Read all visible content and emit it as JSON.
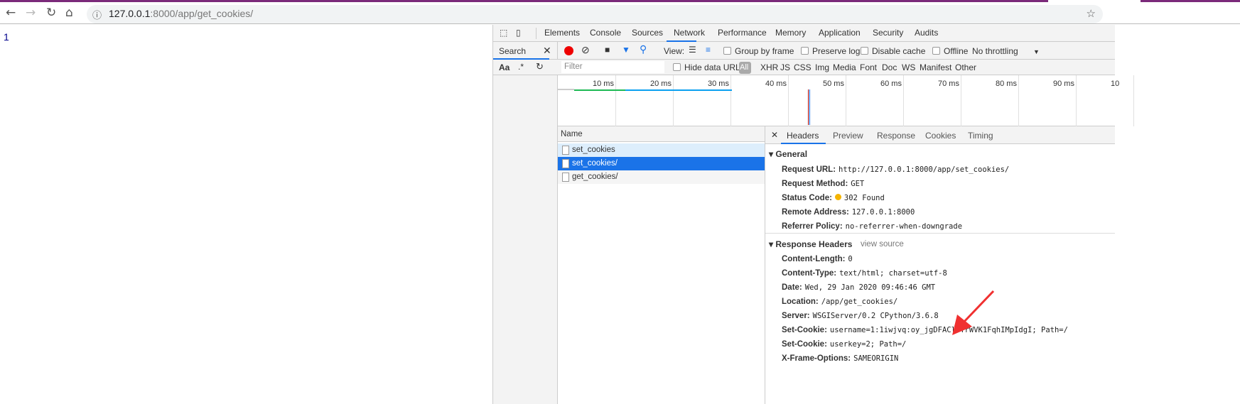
{
  "browser": {
    "url_host": "127.0.0.1",
    "url_rest": ":8000/app/get_cookies/",
    "icons": [
      "back-icon",
      "forward-icon",
      "reload-icon",
      "home-icon",
      "info-icon",
      "star-icon"
    ]
  },
  "page": {
    "content": "1"
  },
  "devtools": {
    "tabs": [
      "Elements",
      "Console",
      "Sources",
      "Network",
      "Performance",
      "Memory",
      "Application",
      "Security",
      "Audits"
    ],
    "active_tab": "Network",
    "search_label": "Search",
    "search_opts": {
      "case": "Aa",
      "regex": ".*"
    },
    "toolbar": {
      "view": "View:",
      "group_by_frame": "Group by frame",
      "preserve_log": "Preserve log",
      "disable_cache": "Disable cache",
      "offline": "Offline",
      "throttling": "No throttling"
    },
    "filter": {
      "placeholder": "Filter",
      "hide_data_urls": "Hide data URLs",
      "types": [
        "All",
        "XHR",
        "JS",
        "CSS",
        "Img",
        "Media",
        "Font",
        "Doc",
        "WS",
        "Manifest",
        "Other"
      ]
    },
    "timeline_ticks": [
      "10 ms",
      "20 ms",
      "30 ms",
      "40 ms",
      "50 ms",
      "60 ms",
      "70 ms",
      "80 ms",
      "90 ms",
      "10"
    ],
    "name_header": "Name",
    "requests": [
      {
        "name": "set_cookies",
        "state": "hover"
      },
      {
        "name": "set_cookies/",
        "state": "selected"
      },
      {
        "name": "get_cookies/",
        "state": "normal"
      }
    ],
    "detail_tabs": [
      "Headers",
      "Preview",
      "Response",
      "Cookies",
      "Timing"
    ],
    "active_detail_tab": "Headers",
    "general_title": "General",
    "general": [
      {
        "k": "Request URL:",
        "v": "http://127.0.0.1:8000/app/set_cookies/"
      },
      {
        "k": "Request Method:",
        "v": "GET"
      },
      {
        "k": "Status Code:",
        "v": "302 Found"
      },
      {
        "k": "Remote Address:",
        "v": "127.0.0.1:8000"
      },
      {
        "k": "Referrer Policy:",
        "v": "no-referrer-when-downgrade"
      }
    ],
    "status_color": "#f4b400",
    "response_title": "Response Headers",
    "view_source": "view source",
    "response": [
      {
        "k": "Content-Length:",
        "v": "0"
      },
      {
        "k": "Content-Type:",
        "v": "text/html; charset=utf-8"
      },
      {
        "k": "Date:",
        "v": "Wed, 29 Jan 2020 09:46:46 GMT"
      },
      {
        "k": "Location:",
        "v": "/app/get_cookies/"
      },
      {
        "k": "Server:",
        "v": "WSGIServer/0.2 CPython/3.6.8"
      },
      {
        "k": "Set-Cookie:",
        "v": "username=1:1iwjvq:oy_jgDFACl6YrWVK1FqhIMpIdgI; Path=/"
      },
      {
        "k": "Set-Cookie:",
        "v": "userkey=2; Path=/"
      },
      {
        "k": "X-Frame-Options:",
        "v": "SAMEORIGIN"
      }
    ]
  },
  "annotation": {
    "arrow_color": "#f03030"
  }
}
